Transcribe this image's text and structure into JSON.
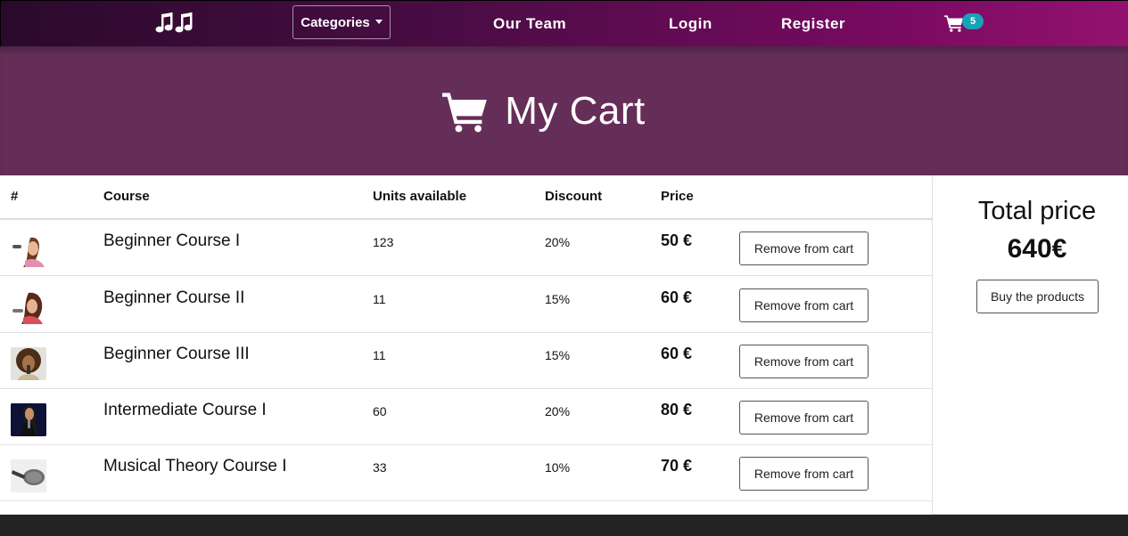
{
  "nav": {
    "categories_label": "Categories",
    "links": [
      "Our Team",
      "Login",
      "Register"
    ],
    "cart_count": "5"
  },
  "hero": {
    "title": "My Cart"
  },
  "table": {
    "headers": [
      "#",
      "Course",
      "Units available",
      "Discount",
      "Price"
    ],
    "rows": [
      {
        "image": "singer-photo-1",
        "course": "Beginner Course I",
        "units": "123",
        "discount": "20%",
        "price": "50 €",
        "action": "Remove from cart"
      },
      {
        "image": "singer-photo-2",
        "course": "Beginner Course II",
        "units": "11",
        "discount": "15%",
        "price": "60 €",
        "action": "Remove from cart"
      },
      {
        "image": "singer-photo-3",
        "course": "Beginner Course III",
        "units": "11",
        "discount": "15%",
        "price": "60 €",
        "action": "Remove from cart"
      },
      {
        "image": "singer-photo-4",
        "course": "Intermediate Course I",
        "units": "60",
        "discount": "20%",
        "price": "80 €",
        "action": "Remove from cart"
      },
      {
        "image": "microphone-photo",
        "course": "Musical Theory Course I",
        "units": "33",
        "discount": "10%",
        "price": "70 €",
        "action": "Remove from cart"
      }
    ]
  },
  "summary": {
    "title": "Total price",
    "total": "640€",
    "buy_label": "Buy the products"
  },
  "colors": {
    "hero_bg": "#652e58",
    "badge": "#17a2b8",
    "nav_gradient_start": "#2a0a2c",
    "nav_gradient_end": "#93126f"
  }
}
